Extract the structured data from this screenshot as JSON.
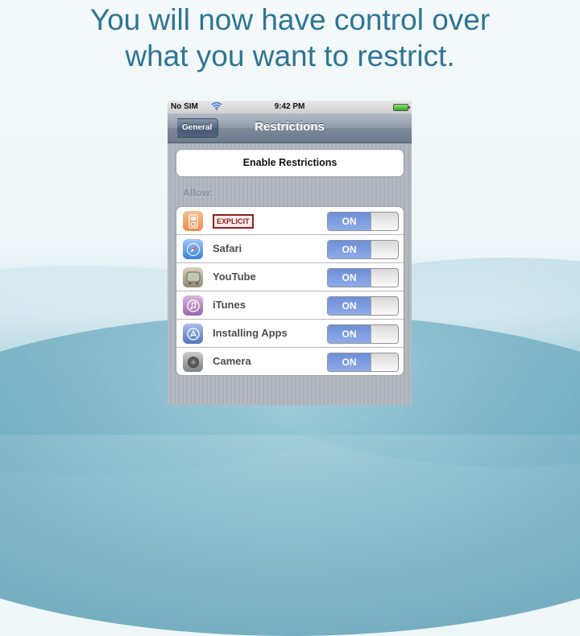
{
  "slide": {
    "title_lines": [
      "You will now have control over",
      "what you want to restrict."
    ]
  },
  "phone": {
    "status_bar": {
      "carrier": "No SIM",
      "wifi_icon": "wifi-icon",
      "time": "9:42 PM",
      "battery_icon": "battery-icon"
    },
    "nav_bar": {
      "back_label": "General",
      "title": "Restrictions"
    },
    "enable_button_label": "Enable Restrictions",
    "section_label": "Allow:",
    "items": [
      {
        "label": "EXPLICIT",
        "icon": "ipod-icon",
        "icon_color": "#f4a26a",
        "toggle": "ON",
        "is_badge": true
      },
      {
        "label": "Safari",
        "icon": "safari-icon",
        "icon_color": "#5b8fd8",
        "toggle": "ON",
        "is_badge": false
      },
      {
        "label": "YouTube",
        "icon": "youtube-icon",
        "icon_color": "#a69f88",
        "toggle": "ON",
        "is_badge": false
      },
      {
        "label": "iTunes",
        "icon": "itunes-icon",
        "icon_color": "#b88bc2",
        "toggle": "ON",
        "is_badge": false
      },
      {
        "label": "Installing Apps",
        "icon": "app-store-icon",
        "icon_color": "#6a8fcc",
        "toggle": "ON",
        "is_badge": false
      },
      {
        "label": "Camera",
        "icon": "camera-icon",
        "icon_color": "#8a8d91",
        "toggle": "ON",
        "is_badge": false
      }
    ],
    "colors": {
      "toggle_on": "#7b9be0",
      "explicit_border": "#8c2323",
      "title_color": "#2e7594"
    }
  }
}
